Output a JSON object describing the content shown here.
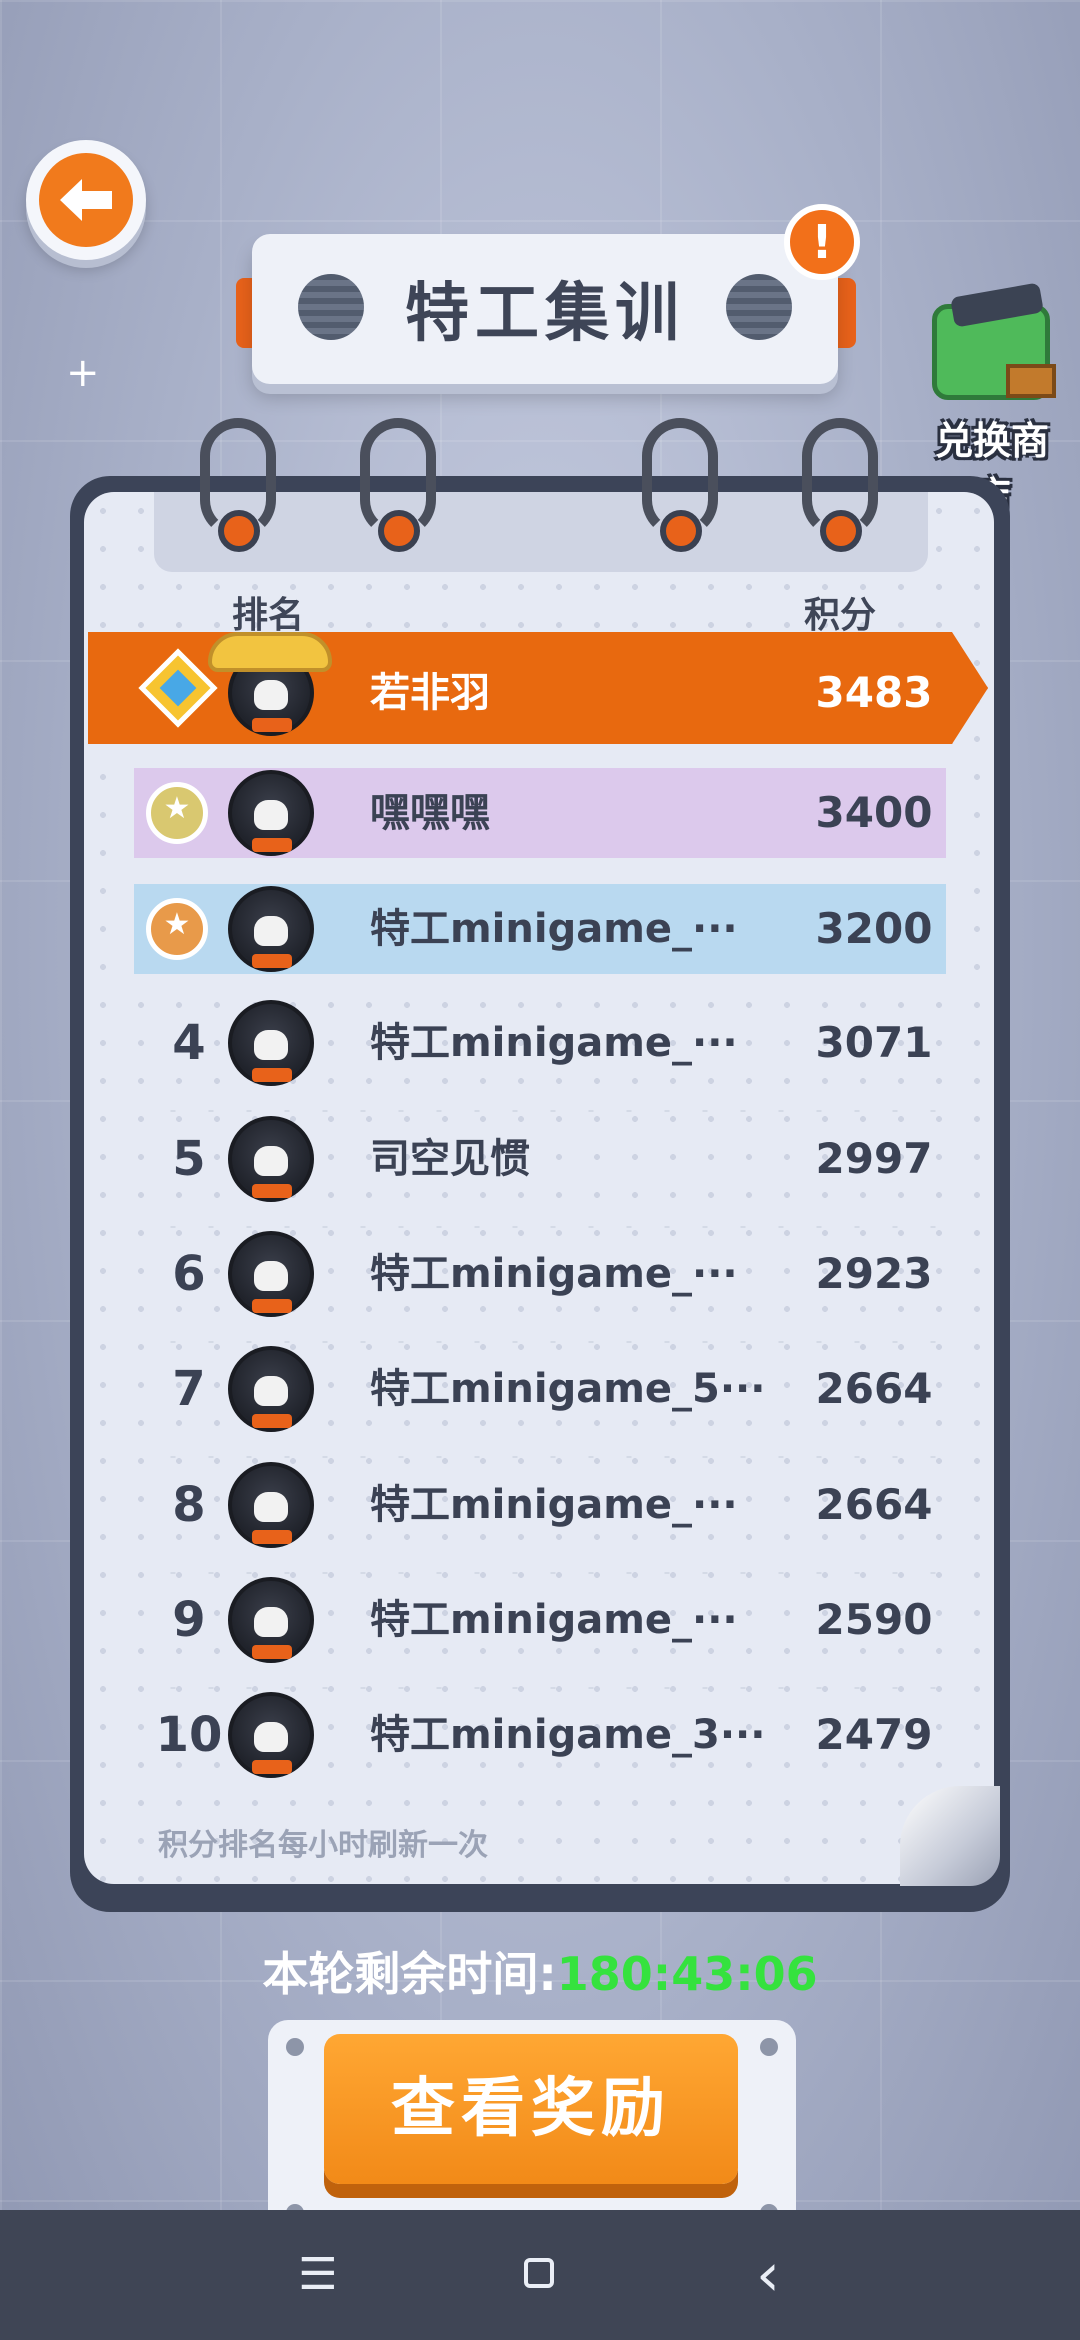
{
  "title": "特工集训",
  "alert": "!",
  "shop_label": "兑换商店",
  "headers": {
    "rank": "排名",
    "score": "积分"
  },
  "rows": [
    {
      "rank": "",
      "name": "若非羽",
      "score": "3483"
    },
    {
      "rank": "",
      "name": "嘿嘿嘿",
      "score": "3400"
    },
    {
      "rank": "",
      "name": "特工minigame_···",
      "score": "3200"
    },
    {
      "rank": "4",
      "name": "特工minigame_···",
      "score": "3071"
    },
    {
      "rank": "5",
      "name": "司空见惯",
      "score": "2997"
    },
    {
      "rank": "6",
      "name": "特工minigame_···",
      "score": "2923"
    },
    {
      "rank": "7",
      "name": "特工minigame_5···",
      "score": "2664"
    },
    {
      "rank": "8",
      "name": "特工minigame_···",
      "score": "2664"
    },
    {
      "rank": "9",
      "name": "特工minigame_···",
      "score": "2590"
    },
    {
      "rank": "10",
      "name": "特工minigame_3···",
      "score": "2479"
    }
  ],
  "footer_note": "积分排名每小时刷新一次",
  "timer": {
    "label": "本轮剩余时间:",
    "value": "180:43:06"
  },
  "reward_button": "查看奖励",
  "nav": {
    "menu": "☰",
    "back": "‹"
  },
  "colors": {
    "accent": "#e8690f",
    "row2": "#dcc9ec",
    "row3": "#b9d9f0",
    "timer": "#35e23e"
  }
}
